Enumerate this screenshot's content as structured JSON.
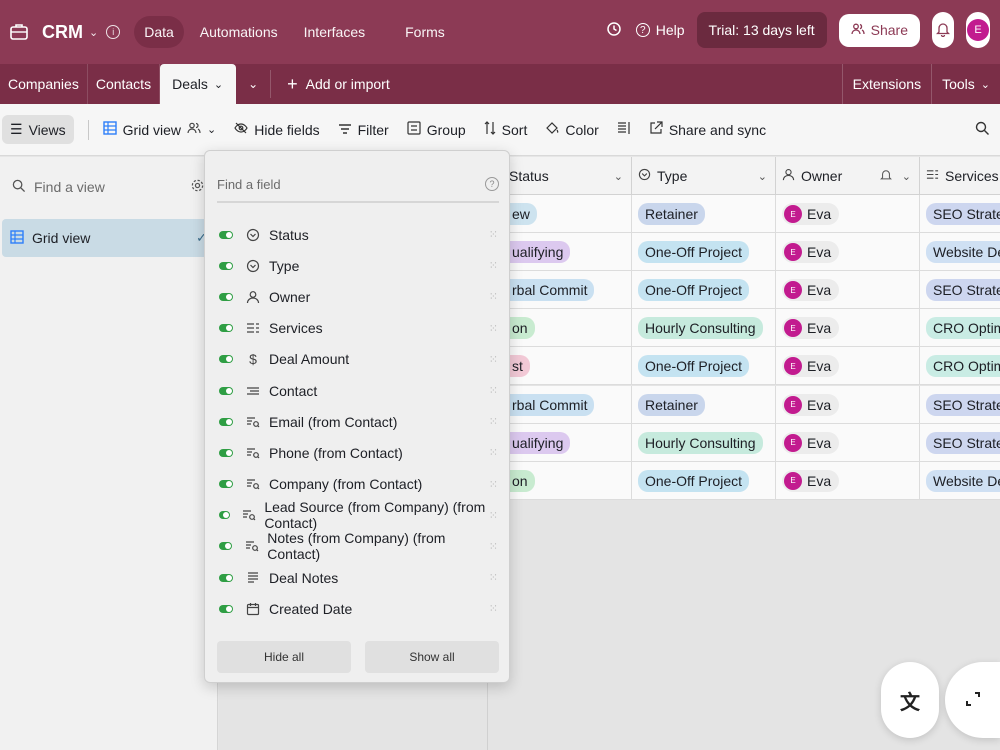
{
  "header": {
    "base_name": "CRM",
    "tabs": [
      "Data",
      "Automations",
      "Interfaces",
      "Forms"
    ],
    "help_label": "Help",
    "trial_label": "Trial: 13 days left",
    "share_label": "Share",
    "avatar_initial": "E"
  },
  "table_tabs": {
    "tabs": [
      "Companies",
      "Contacts",
      "Deals"
    ],
    "active": "Deals",
    "add_import_label": "Add or import",
    "extensions_label": "Extensions",
    "tools_label": "Tools"
  },
  "viewbar": {
    "views_label": "Views",
    "grid_view_label": "Grid view",
    "hide_fields_label": "Hide fields",
    "filter_label": "Filter",
    "group_label": "Group",
    "sort_label": "Sort",
    "color_label": "Color",
    "share_sync_label": "Share and sync"
  },
  "sidebar": {
    "find_placeholder": "Find a view",
    "active_view": "Grid view"
  },
  "grid": {
    "columns": [
      "Status",
      "Type",
      "Owner",
      "Services"
    ],
    "rows": [
      {
        "status": "ew",
        "type": "Retainer",
        "owner": "Eva",
        "service": "SEO Strategy"
      },
      {
        "status": "ualifying",
        "type": "One-Off Project",
        "owner": "Eva",
        "service": "Website Desig"
      },
      {
        "status": "rbal Commit",
        "type": "One-Off Project",
        "owner": "Eva",
        "service": "SEO Strategy"
      },
      {
        "status": "on",
        "type": "Hourly Consulting",
        "owner": "Eva",
        "service": "CRO Optimiza"
      },
      {
        "status": "st",
        "type": "One-Off Project",
        "owner": "Eva",
        "service": "CRO Optimiza"
      },
      {
        "status": "rbal Commit",
        "type": "Retainer",
        "owner": "Eva",
        "service": "SEO Strategy"
      },
      {
        "status": "ualifying",
        "type": "Hourly Consulting",
        "owner": "Eva",
        "service": "SEO Strategy"
      },
      {
        "status": "on",
        "type": "One-Off Project",
        "owner": "Eva",
        "service": "Website Desig"
      }
    ],
    "owner_initial": "E"
  },
  "hide_fields_menu": {
    "search_placeholder": "Find a field",
    "fields": [
      {
        "label": "Status",
        "icon": "status-icon"
      },
      {
        "label": "Type",
        "icon": "single-select-icon"
      },
      {
        "label": "Owner",
        "icon": "user-icon"
      },
      {
        "label": "Services",
        "icon": "multi-select-icon"
      },
      {
        "label": "Deal Amount",
        "icon": "currency-icon"
      },
      {
        "label": "Contact",
        "icon": "link-icon"
      },
      {
        "label": "Email (from Contact)",
        "icon": "lookup-icon"
      },
      {
        "label": "Phone (from Contact)",
        "icon": "lookup-icon"
      },
      {
        "label": "Company (from Contact)",
        "icon": "lookup-icon"
      },
      {
        "label": "Lead Source (from Company) (from Contact)",
        "icon": "lookup-icon"
      },
      {
        "label": "Notes (from Company) (from Contact)",
        "icon": "lookup-icon"
      },
      {
        "label": "Deal Notes",
        "icon": "long-text-icon"
      },
      {
        "label": "Created Date",
        "icon": "calendar-icon"
      }
    ],
    "hide_all_label": "Hide all",
    "show_all_label": "Show all"
  },
  "colors": {
    "header_bg": "#8c3a55",
    "tabbar_bg": "#7a2e47",
    "toggle_on": "#2f9e44",
    "avatar": "#c21b8f",
    "pill_retainer": "#c9d6ec",
    "pill_oneoff": "#c4e3f1",
    "pill_hourly": "#c6eadd",
    "pill_seo": "#cdd6ef",
    "pill_web": "#cfe0f3",
    "pill_cro": "#c9ece4"
  }
}
